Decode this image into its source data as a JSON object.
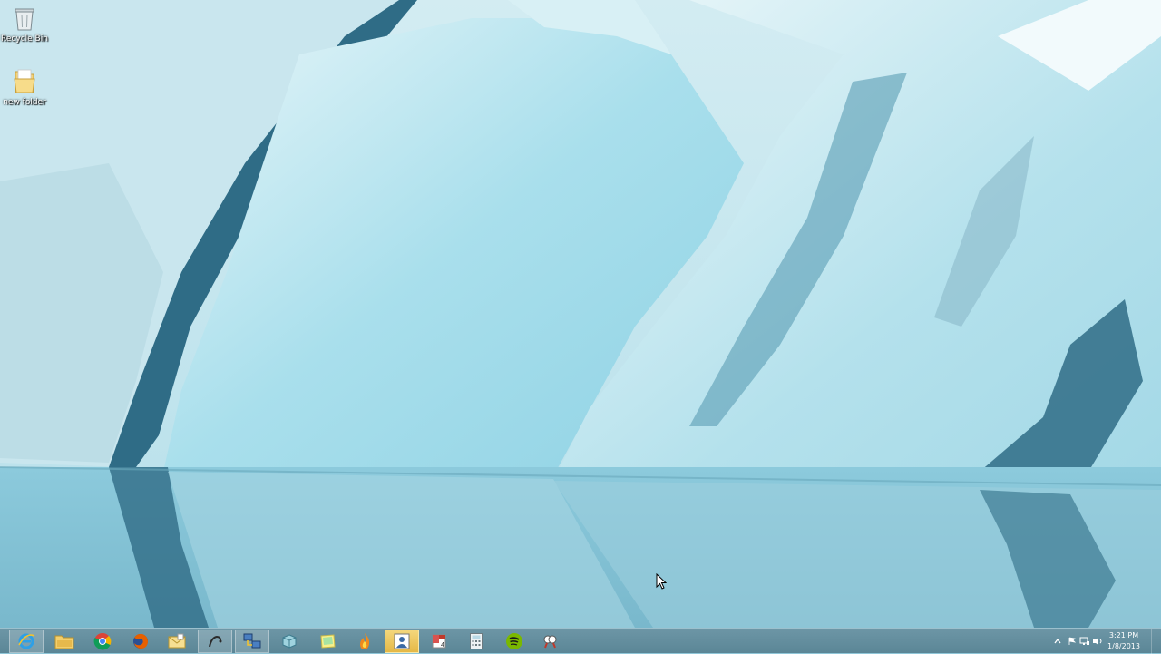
{
  "desktop": {
    "icons": [
      {
        "label": "Recycle Bin",
        "icon": "recycle-bin-icon"
      },
      {
        "label": "new folder",
        "icon": "folder-icon"
      }
    ]
  },
  "taskbar": {
    "pinned": [
      {
        "name": "Internet Explorer",
        "icon": "internet-explorer-icon"
      },
      {
        "name": "File Explorer",
        "icon": "file-explorer-icon"
      },
      {
        "name": "Google Chrome",
        "icon": "chrome-icon"
      },
      {
        "name": "Firefox",
        "icon": "firefox-icon"
      },
      {
        "name": "Mail",
        "icon": "mail-icon"
      },
      {
        "name": "Pen tool",
        "icon": "pen-icon"
      },
      {
        "name": "Network",
        "icon": "network-icon"
      },
      {
        "name": "App",
        "icon": "cube-icon"
      },
      {
        "name": "Sticky Notes",
        "icon": "sticky-notes-icon"
      },
      {
        "name": "Burner",
        "icon": "flame-icon"
      },
      {
        "name": "Contacts",
        "icon": "contacts-icon"
      },
      {
        "name": "Calendar",
        "icon": "calendar-icon"
      },
      {
        "name": "Calculator",
        "icon": "calculator-icon"
      },
      {
        "name": "Spotify",
        "icon": "spotify-icon"
      },
      {
        "name": "Snipping Tool",
        "icon": "snipping-tool-icon"
      }
    ],
    "calendar_badge": "4",
    "tray": {
      "time": "3:21 PM",
      "date": "1/8/2013"
    }
  },
  "colors": {
    "taskbar": "#5b8696",
    "ice": "#a7dce9",
    "water": "#6fb3c8",
    "highlight": "#e5b845"
  }
}
